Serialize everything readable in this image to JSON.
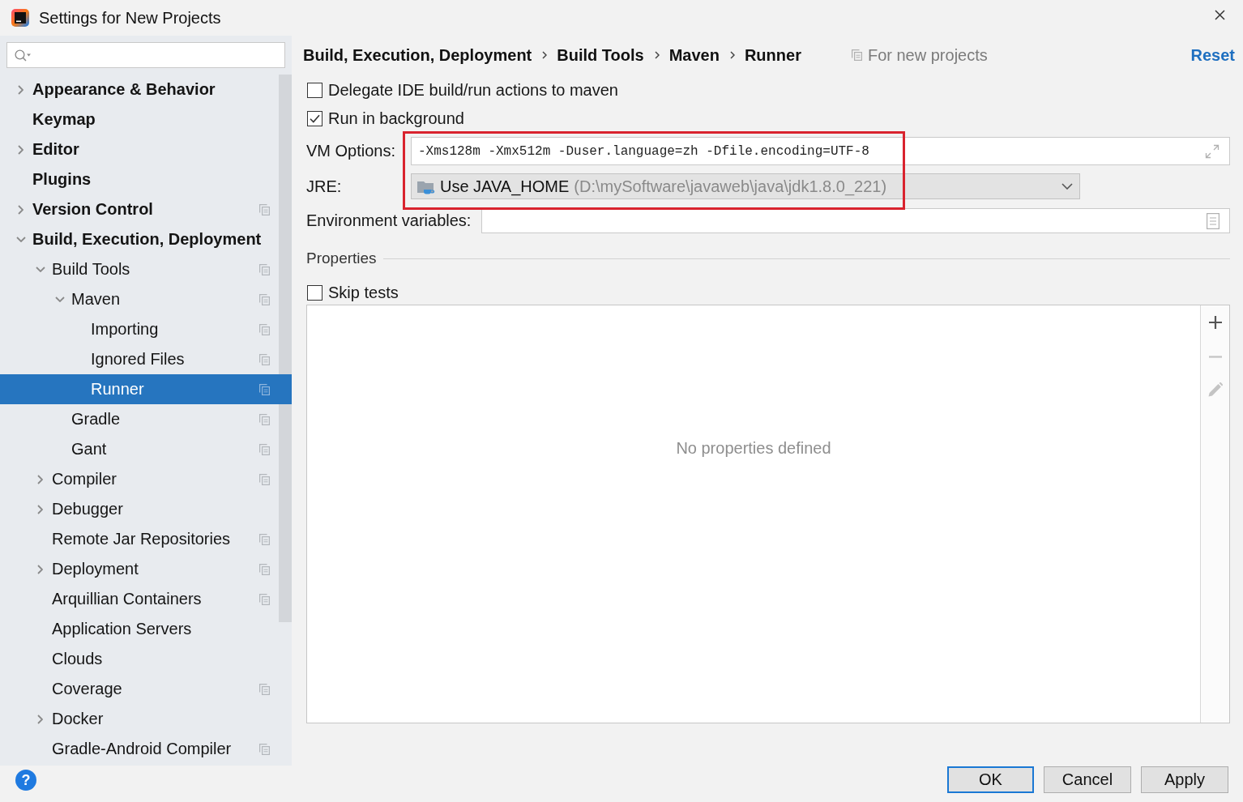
{
  "window": {
    "title": "Settings for New Projects"
  },
  "sidebar": {
    "items": [
      {
        "label": "Appearance & Behavior",
        "expanded": false,
        "selected": false,
        "project_level": false
      },
      {
        "label": "Keymap",
        "selected": false,
        "project_level": false
      },
      {
        "label": "Editor",
        "expanded": false,
        "selected": false,
        "project_level": false
      },
      {
        "label": "Plugins",
        "selected": false,
        "project_level": false
      },
      {
        "label": "Version Control",
        "expanded": false,
        "selected": false,
        "project_level": true
      },
      {
        "label": "Build, Execution, Deployment",
        "expanded": true,
        "selected": false,
        "project_level": false,
        "children": [
          {
            "label": "Build Tools",
            "expanded": true,
            "selected": false,
            "project_level": true,
            "children": [
              {
                "label": "Maven",
                "expanded": true,
                "selected": false,
                "project_level": true,
                "children": [
                  {
                    "label": "Importing",
                    "selected": false,
                    "project_level": true
                  },
                  {
                    "label": "Ignored Files",
                    "selected": false,
                    "project_level": true
                  },
                  {
                    "label": "Runner",
                    "selected": true,
                    "project_level": true
                  }
                ]
              },
              {
                "label": "Gradle",
                "selected": false,
                "project_level": true
              },
              {
                "label": "Gant",
                "selected": false,
                "project_level": true
              }
            ]
          },
          {
            "label": "Compiler",
            "expanded": false,
            "selected": false,
            "project_level": true
          },
          {
            "label": "Debugger",
            "expanded": false,
            "selected": false,
            "project_level": false
          },
          {
            "label": "Remote Jar Repositories",
            "selected": false,
            "project_level": true
          },
          {
            "label": "Deployment",
            "expanded": false,
            "selected": false,
            "project_level": true
          },
          {
            "label": "Arquillian Containers",
            "selected": false,
            "project_level": true
          },
          {
            "label": "Application Servers",
            "selected": false,
            "project_level": false
          },
          {
            "label": "Clouds",
            "selected": false,
            "project_level": false
          },
          {
            "label": "Coverage",
            "selected": false,
            "project_level": true
          },
          {
            "label": "Docker",
            "expanded": false,
            "selected": false,
            "project_level": false
          },
          {
            "label": "Gradle-Android Compiler",
            "selected": false,
            "project_level": true
          }
        ]
      }
    ]
  },
  "breadcrumb": [
    "Build, Execution, Deployment",
    "Build Tools",
    "Maven",
    "Runner"
  ],
  "scope_note": "For new projects",
  "reset_link": "Reset",
  "options": [
    {
      "label": "Delegate IDE build/run actions to maven",
      "checked": false
    },
    {
      "label": "Run in background",
      "checked": true
    }
  ],
  "fields": [
    {
      "kind": "expandable",
      "label": "VM Options:",
      "value": "-Xms128m -Xmx512m -Duser.language=zh -Dfile.encoding=UTF-8",
      "highlighted": true
    },
    {
      "kind": "select",
      "label": "JRE:",
      "value": "Use JAVA_HOME",
      "detail": "(D:\\mySoftware\\javaweb\\java\\jdk1.8.0_221)",
      "highlighted": true
    },
    {
      "kind": "dialog",
      "label": "Environment variables:",
      "highlighted": false
    }
  ],
  "properties": {
    "title": "Properties",
    "skip_tests": {
      "label": "Skip tests",
      "checked": false
    },
    "empty_text": "No properties defined",
    "toolbar": [
      {
        "kind": "add",
        "disabled": false
      },
      {
        "kind": "remove",
        "disabled": true
      },
      {
        "kind": "edit",
        "disabled": true
      }
    ]
  },
  "help_button": "?",
  "buttons": [
    {
      "label": "OK",
      "default": true
    },
    {
      "label": "Cancel",
      "default": false
    },
    {
      "label": "Apply",
      "default": false
    }
  ]
}
